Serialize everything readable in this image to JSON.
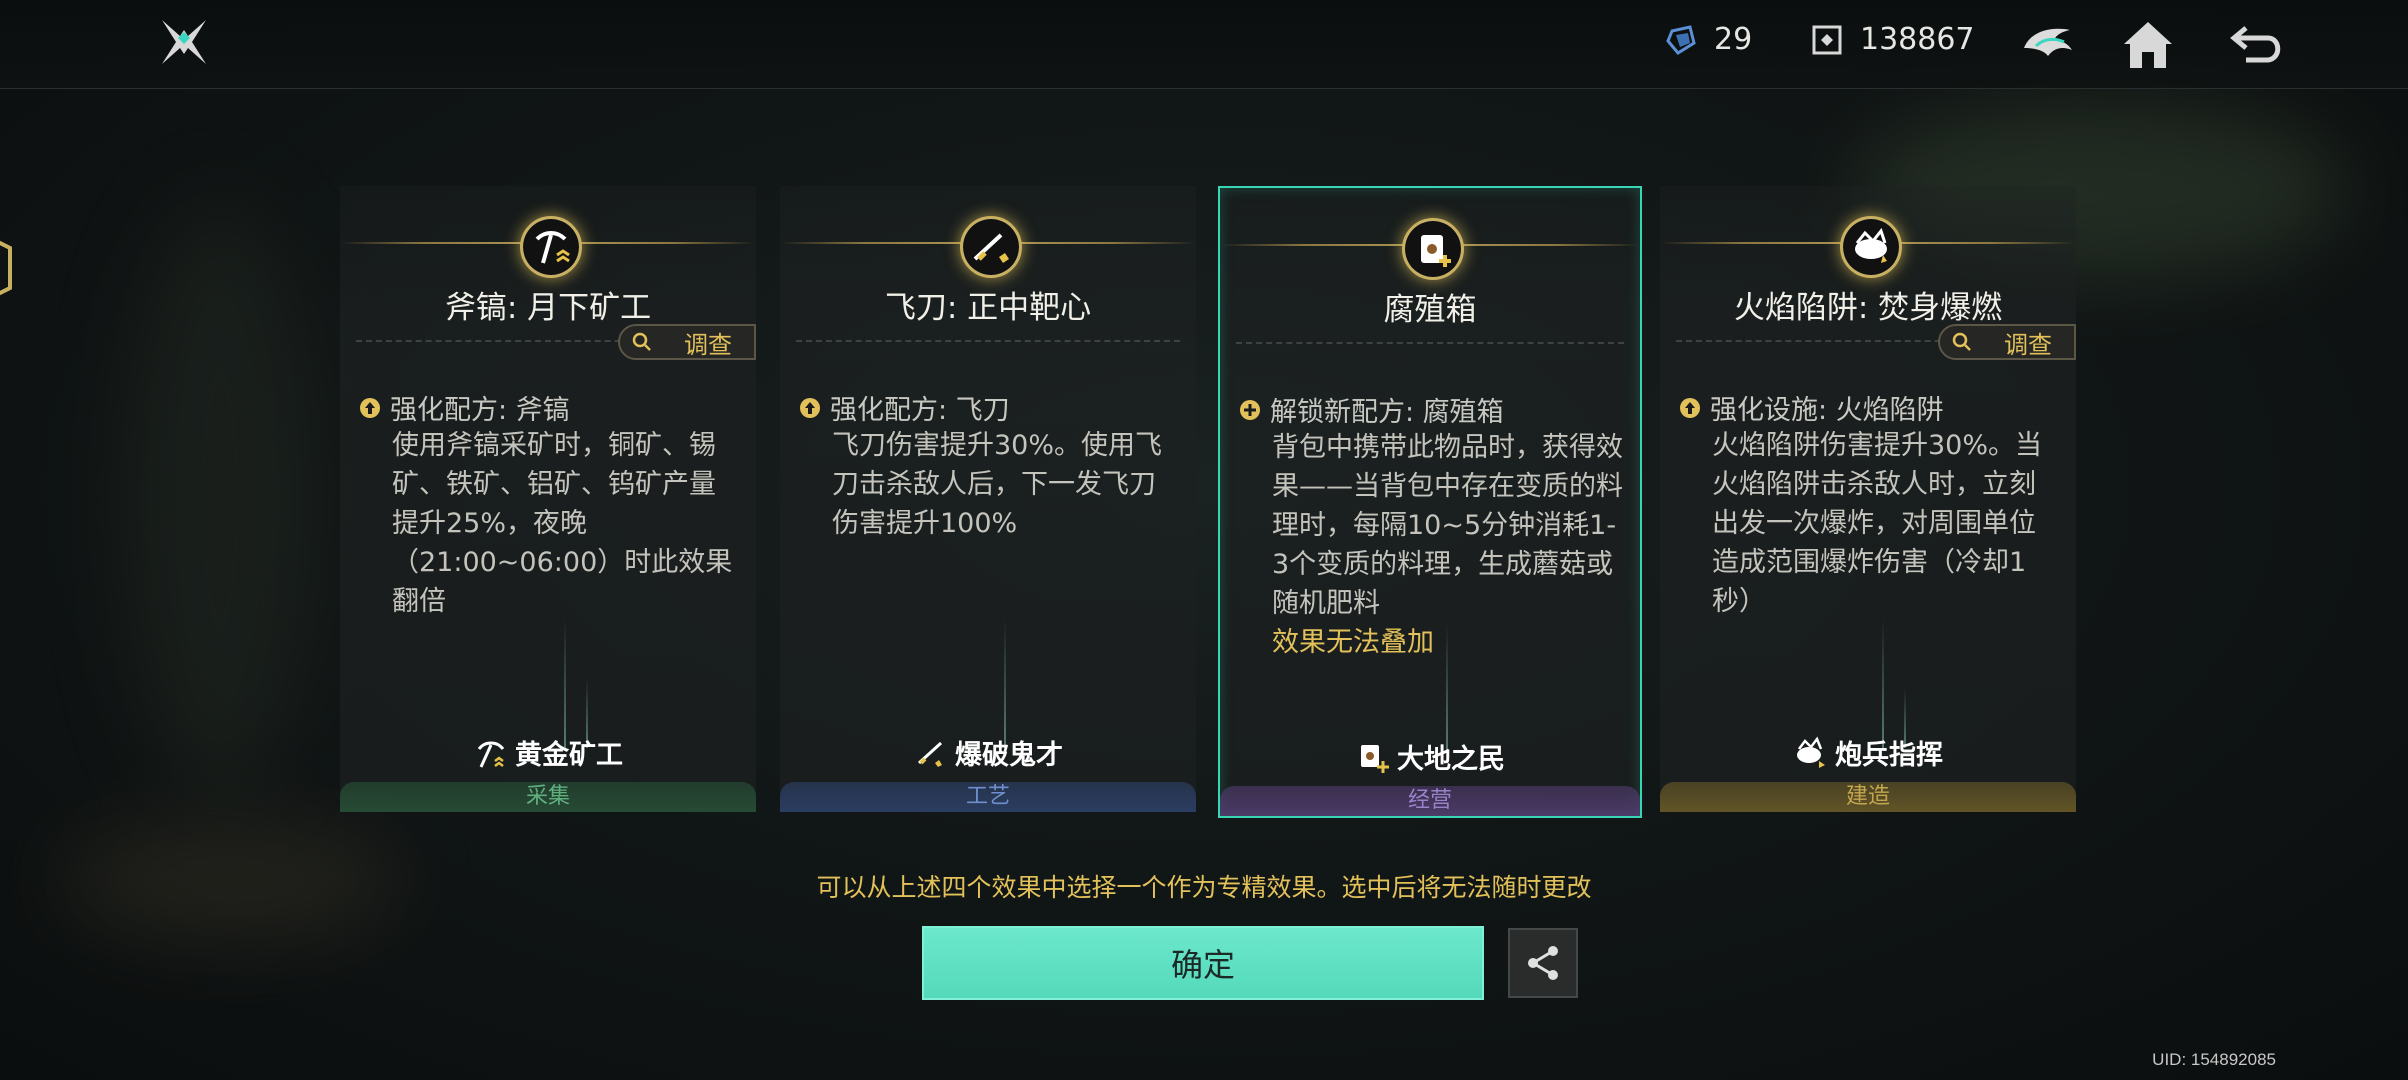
{
  "header": {
    "currency1": "29",
    "currency2": "138867"
  },
  "cards": [
    {
      "title": "斧镐: 月下矿工",
      "survey": "调查",
      "effect_head": "强化配方: 斧镐",
      "effect_body": "使用斧镐采矿时，铜矿、锡矿、铁矿、铝矿、钨矿产量提升25%，夜晚（21:00~06:00）时此效果翻倍",
      "effect_warn": "",
      "talent": "黄金矿工",
      "category": "采集",
      "category_color": "#3f8c5a"
    },
    {
      "title": "飞刀: 正中靶心",
      "survey": "",
      "effect_head": "强化配方: 飞刀",
      "effect_body": "飞刀伤害提升30%。使用飞刀击杀敌人后，下一发飞刀伤害提升100%",
      "effect_warn": "",
      "talent": "爆破鬼才",
      "category": "工艺",
      "category_color": "#4a6ca8"
    },
    {
      "title": "腐殖箱",
      "survey": "",
      "effect_head": "解锁新配方: 腐殖箱",
      "effect_body": "背包中携带此物品时，获得效果——当背包中存在变质的料理时，每隔10~5分钟消耗1-3个变质的料理，生成蘑菇或随机肥料",
      "effect_warn": "效果无法叠加",
      "talent": "大地之民",
      "category": "经营",
      "category_color": "#7a5ca8"
    },
    {
      "title": "火焰陷阱: 焚身爆燃",
      "survey": "调查",
      "effect_head": "强化设施: 火焰陷阱",
      "effect_body": "火焰陷阱伤害提升30%。当火焰陷阱击杀敌人时，立刻出发一次爆炸，对周围单位造成范围爆炸伤害（冷却1秒）",
      "effect_warn": "",
      "talent": "炮兵指挥",
      "category": "建造",
      "category_color": "#a8913f"
    }
  ],
  "hint": "可以从上述四个效果中选择一个作为专精效果。选中后将无法随时更改",
  "confirm_label": "确定",
  "uid": "UID: 154892085",
  "colors": {
    "accent": "#5ddcbf",
    "gold": "#e2c15a"
  }
}
